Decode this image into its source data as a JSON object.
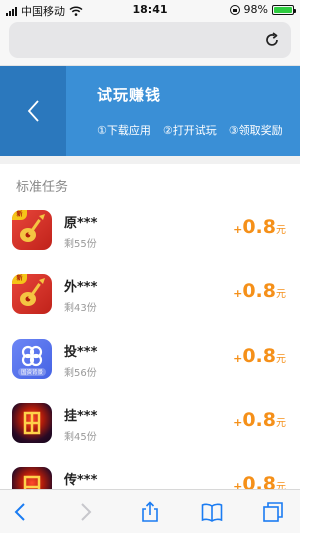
{
  "status_bar": {
    "carrier": "中国移动",
    "time": "18:41",
    "battery": "98%",
    "battery_level": 0.98
  },
  "header": {
    "title": "试玩赚钱",
    "steps": [
      "①下载应用",
      "②打开试玩",
      "③领取奖励"
    ]
  },
  "section": {
    "title": "标准任务"
  },
  "tasks": [
    {
      "name": "原***",
      "left": "剩55份",
      "plus": "+",
      "amount": "0.8",
      "unit": "元",
      "icon": "red-icon"
    },
    {
      "name": "外***",
      "left": "剩43份",
      "plus": "+",
      "amount": "0.8",
      "unit": "元",
      "icon": "red-icon"
    },
    {
      "name": "投***",
      "left": "剩56份",
      "plus": "+",
      "amount": "0.8",
      "unit": "元",
      "icon": "blue-icon",
      "icon_text": "国资背景"
    },
    {
      "name": "挂***",
      "left": "剩45份",
      "plus": "+",
      "amount": "0.8",
      "unit": "元",
      "icon": "game-icon"
    },
    {
      "name": "传***",
      "left": "",
      "plus": "+",
      "amount": "0.8",
      "unit": "元",
      "icon": "game-icon"
    }
  ],
  "colors": {
    "header_blue": "#3a8fd6",
    "header_dark": "#2b78bd",
    "reward_orange": "#f59019",
    "ios_blue": "#1b7cf2"
  }
}
